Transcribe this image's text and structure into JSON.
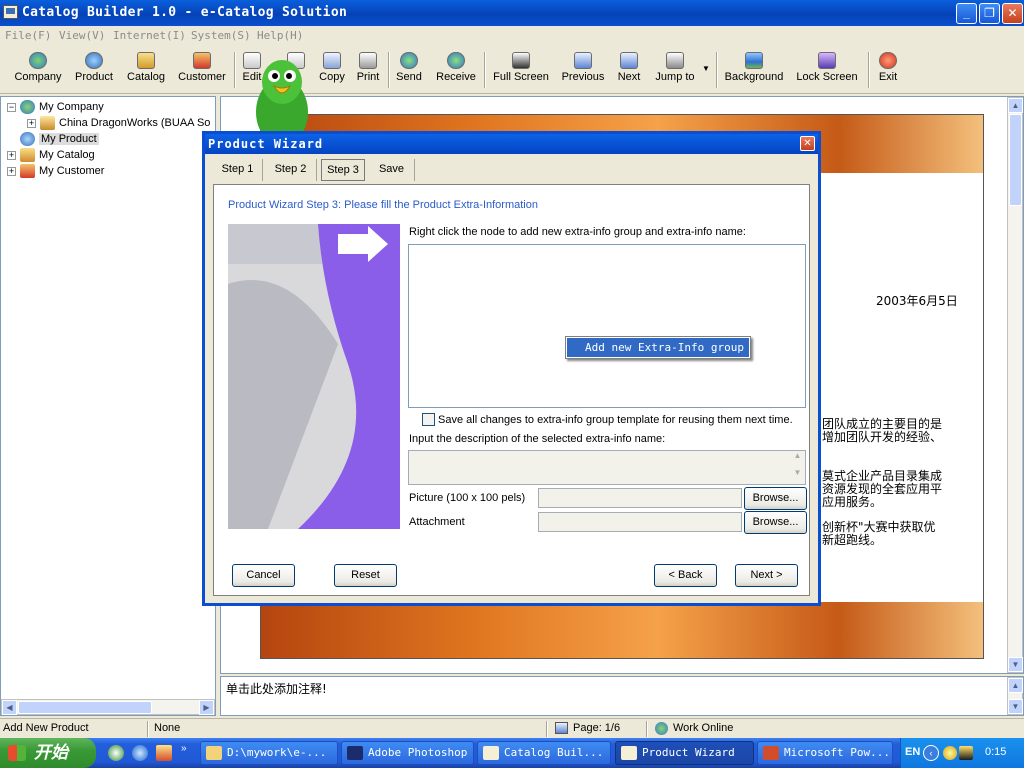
{
  "window": {
    "title": "Catalog Builder 1.0 - e-Catalog Solution"
  },
  "menu": [
    "File(F)",
    "View(V)",
    "Internet(I)",
    "System(S)",
    "Help(H)"
  ],
  "toolbar": {
    "company": "Company",
    "product": "Product",
    "catalog": "Catalog",
    "customer": "Customer",
    "edit": "Edit",
    "delete": "te",
    "copy": "Copy",
    "print": "Print",
    "send": "Send",
    "receive": "Receive",
    "fullscreen": "Full Screen",
    "previous": "Previous",
    "next": "Next",
    "jumpto": "Jump to",
    "background": "Background",
    "lockscreen": "Lock Screen",
    "exit": "Exit"
  },
  "tree": {
    "company": "My Company",
    "company_child": "China DragonWorks (BUAA So",
    "product": "My Product",
    "catalog": "My Catalog",
    "customer": "My Customer"
  },
  "doc": {
    "date": "2003年6月5日",
    "line1": "团队成立的主要目的是",
    "line2": "增加团队开发的经验、",
    "line3": "莫式企业产品目录集成",
    "line4": "资源发现的全套应用平",
    "line5": "应用服务。",
    "line6": "创新杯\"大赛中获取优",
    "line7": "新超跑线。"
  },
  "note": {
    "text": "单击此处添加注释!"
  },
  "dialog": {
    "title": "Product Wizard",
    "tabs": [
      "Step 1",
      "Step 2",
      "Step 3",
      "Save"
    ],
    "heading": "Product Wizard Step 3: Please fill the Product Extra-Information",
    "tree_instruction": "Right click the node to add new extra-info group and extra-info name:",
    "context_item": "Add new Extra-Info group",
    "save_template_label": "Save all changes to extra-info group template for reusing them next time.",
    "description_label": "Input the description of the selected extra-info name:",
    "picture_label": "Picture (100 x 100 pels)",
    "attachment_label": "Attachment",
    "browse": "Browse...",
    "cancel": "Cancel",
    "reset": "Reset",
    "back": "< Back",
    "next": "Next >"
  },
  "status": {
    "action": "Add New Product",
    "mode": "None",
    "page": "Page: 1/6",
    "online": "Work Online"
  },
  "taskbar": {
    "start": "开始",
    "tasks": [
      "D:\\mywork\\e-...",
      "Adobe Photoshop",
      "Catalog Buil...",
      "Product Wizard",
      "Microsoft Pow..."
    ],
    "lang": "EN",
    "clock": "0:15"
  }
}
